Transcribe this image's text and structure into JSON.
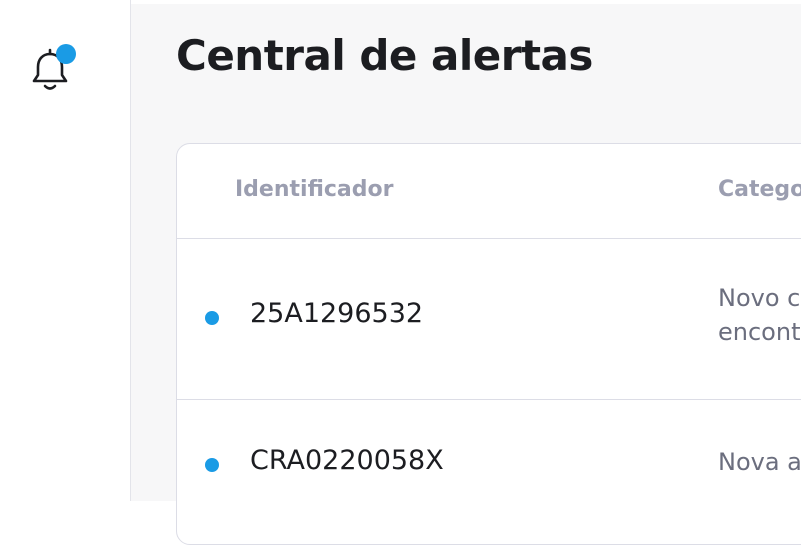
{
  "colors": {
    "accent": "#1a9be5",
    "title": "#1c1d21",
    "header_text": "#9b9eb0",
    "muted_text": "#6b6e7e"
  },
  "sidebar": {
    "notification_icon": "bell-icon",
    "has_unread": true
  },
  "page": {
    "title": "Central de alertas"
  },
  "table": {
    "columns": [
      "Identificador",
      "Catego"
    ],
    "rows": [
      {
        "id": "25A1296532",
        "category_line1": "Novo c",
        "category_line2": "encont",
        "unread": true
      },
      {
        "id": "CRA0220058X",
        "category_line1": "Nova a",
        "category_line2": "",
        "unread": true
      }
    ]
  }
}
